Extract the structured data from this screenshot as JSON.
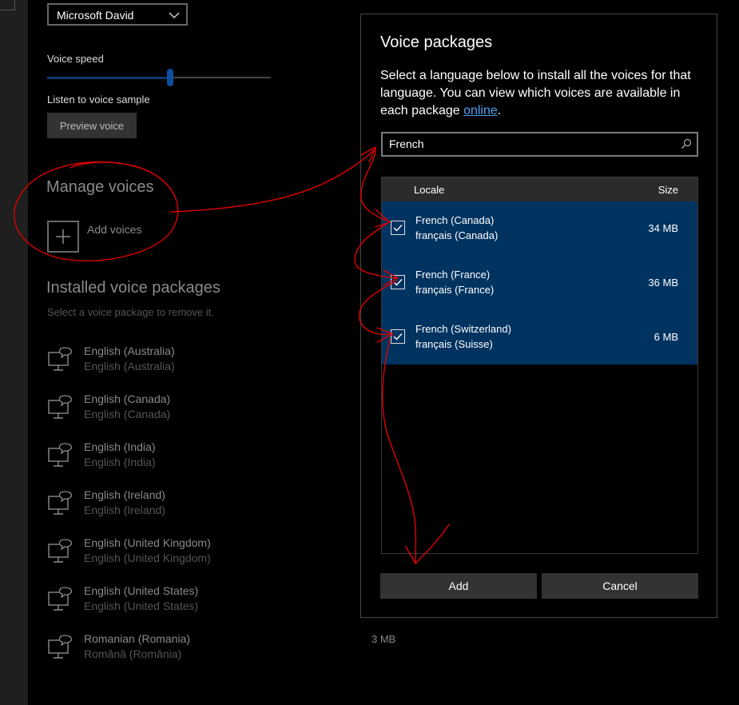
{
  "settings": {
    "voice_select_value": "Microsoft David",
    "voice_speed_label": "Voice speed",
    "voice_speed_level": 0.55,
    "listen_label": "Listen to voice sample",
    "preview_button": "Preview voice",
    "manage_heading": "Manage voices",
    "add_voices_label": "Add voices",
    "installed_heading": "Installed voice packages",
    "installed_sub": "Select a voice package to remove it.",
    "installed": [
      {
        "name": "English (Australia)",
        "native": "English (Australia)"
      },
      {
        "name": "English (Canada)",
        "native": "English (Canada)"
      },
      {
        "name": "English (India)",
        "native": "English (India)"
      },
      {
        "name": "English (Ireland)",
        "native": "English (Ireland)"
      },
      {
        "name": "English (United Kingdom)",
        "native": "English (United Kingdom)"
      },
      {
        "name": "English (United States)",
        "native": "English (United States)"
      },
      {
        "name": "Romanian (Romania)",
        "native": "Română (România)"
      }
    ],
    "romanian_size": "3 MB"
  },
  "dialog": {
    "title": "Voice packages",
    "desc_prefix": "Select a language below to install all the voices for that language. You can view which voices are available in each package ",
    "desc_link": "online",
    "desc_suffix": ".",
    "search_value": "French",
    "col_locale": "Locale",
    "col_size": "Size",
    "rows": [
      {
        "name": "French (Canada)",
        "native": "français (Canada)",
        "size": "34 MB",
        "checked": true
      },
      {
        "name": "French (France)",
        "native": "français (France)",
        "size": "36 MB",
        "checked": true
      },
      {
        "name": "French (Switzerland)",
        "native": "français (Suisse)",
        "size": "6 MB",
        "checked": true
      }
    ],
    "add_button": "Add",
    "cancel_button": "Cancel"
  },
  "colors": {
    "accent": "#0c4f9e",
    "selected_row": "#003360",
    "annotation": "#e00000"
  }
}
